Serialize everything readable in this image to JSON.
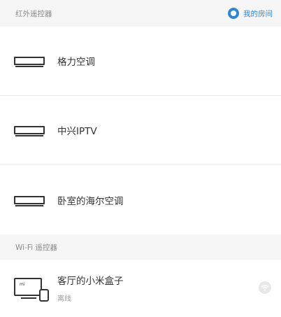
{
  "ir_section": {
    "title": "红外遥控器",
    "room_link": "我的房间",
    "devices": [
      {
        "label": "格力空调"
      },
      {
        "label": "中兴IPTV"
      },
      {
        "label": "卧室的海尔空调"
      }
    ]
  },
  "wifi_section": {
    "title": "Wi-Fi 遥控器",
    "device": {
      "label": "客厅的小米盒子",
      "status": "离线",
      "box_text": "mi"
    }
  },
  "colors": {
    "accent": "#2f86d6",
    "header_bg": "#f5f5f5"
  }
}
